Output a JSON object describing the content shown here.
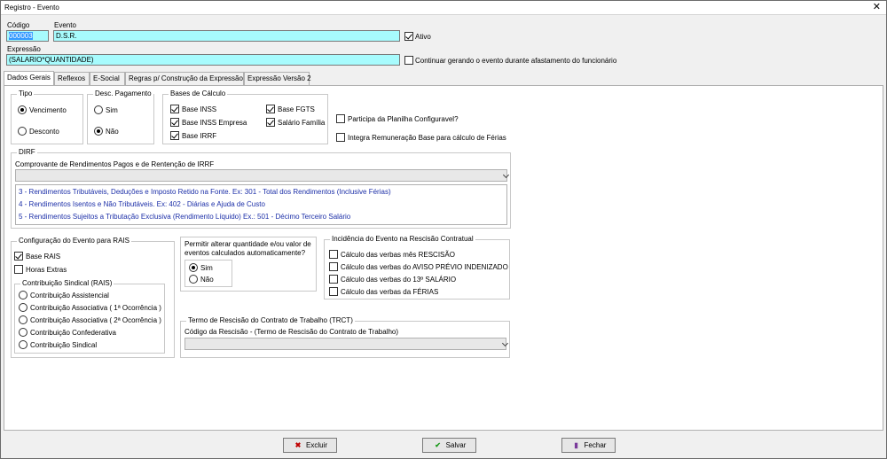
{
  "window": {
    "title": "Registro - Evento",
    "close": "✕"
  },
  "header": {
    "codigo_label": "Código",
    "codigo_value": "000003",
    "evento_label": "Evento",
    "evento_value": "D.S.R.",
    "ativo_label": "Ativo",
    "expressao_label": "Expressão",
    "expressao_value": "(SALARIO*QUANTIDADE)",
    "continuar_label": "Continuar gerando o evento durante afastamento do funcionário"
  },
  "tabs": [
    "Dados Gerais",
    "Reflexos",
    "E-Social",
    "Regras p/ Construção da Expressão",
    "Expressão Versão 2"
  ],
  "tipo": {
    "title": "Tipo",
    "options": [
      "Vencimento",
      "Desconto"
    ],
    "selected": "Vencimento"
  },
  "desc_pagamento": {
    "title": "Desc. Pagamento",
    "options": [
      "Sim",
      "Não"
    ],
    "selected": "Não"
  },
  "bases": {
    "title": "Bases de Cálculo",
    "items": [
      {
        "label": "Base INSS",
        "checked": true
      },
      {
        "label": "Base FGTS",
        "checked": true
      },
      {
        "label": "Base INSS Empresa",
        "checked": true
      },
      {
        "label": "Salário Família",
        "checked": true
      },
      {
        "label": "Base IRRF",
        "checked": true
      }
    ]
  },
  "extras": {
    "planilha_label": "Participa da Planilha Configuravel?",
    "integra_label": "Integra Remuneração Base para cálculo de Férias"
  },
  "dirf": {
    "title": "DIRF",
    "combo_label": "Comprovante de Rendimentos Pagos e de Rentenção de IRRF",
    "lines": [
      "3 - Rendimentos Tributáveis, Deduções e Imposto Retido na  Fonte. Ex: 301 - Total dos Rendimentos (Inclusive Férias)",
      "4 - Rendimentos Isentos e Não Tributáveis.  Ex: 402 - Diárias e Ajuda de Custo",
      "5 - Rendimentos Sujeitos a Tributação Exclusiva (Rendimento Líquido) Ex.: 501 - Décimo Terceiro Salário"
    ]
  },
  "rais": {
    "title": "Configuração do Evento para RAIS",
    "base_rais": "Base RAIS",
    "horas_extras": "Horas Extras",
    "sindical_title": "Contribuição Sindical (RAIS)",
    "sindical_options": [
      "Contribuição Assistencial",
      "Contribuição Associativa ( 1ª Ocorrência )",
      "Contribuição Associativa ( 2ª Ocorrência )",
      "Contribuição Confederativa",
      "Contribuição Sindical"
    ]
  },
  "permitir": {
    "text_line1": "Permitir alterar quantidade e/ou valor de",
    "text_line2": "eventos calculados automaticamente?",
    "options": [
      "Sim",
      "Não"
    ],
    "selected": "Sim"
  },
  "rescisao": {
    "title": "Incidência do Evento na Rescisão Contratual",
    "items": [
      "Cálculo das verbas mês RESCISÃO",
      "Cálculo das verbas do AVISO PRÉVIO INDENIZADO",
      "Cálculo das verbas do 13º SALÁRIO",
      "Cálculo das verbas da FÉRIAS"
    ]
  },
  "trct": {
    "title": "Termo de Rescisão do Contrato de Trabalho (TRCT)",
    "combo_label": "Código da Rescisão - (Termo de Rescisão do Contrato de Trabalho)"
  },
  "buttons": {
    "excluir": "Excluir",
    "salvar": "Salvar",
    "fechar": "Fechar"
  },
  "colors": {
    "field_bg": "#a7fbfd",
    "selection": "#3399ff",
    "dirf_text": "#1c2fa8"
  }
}
